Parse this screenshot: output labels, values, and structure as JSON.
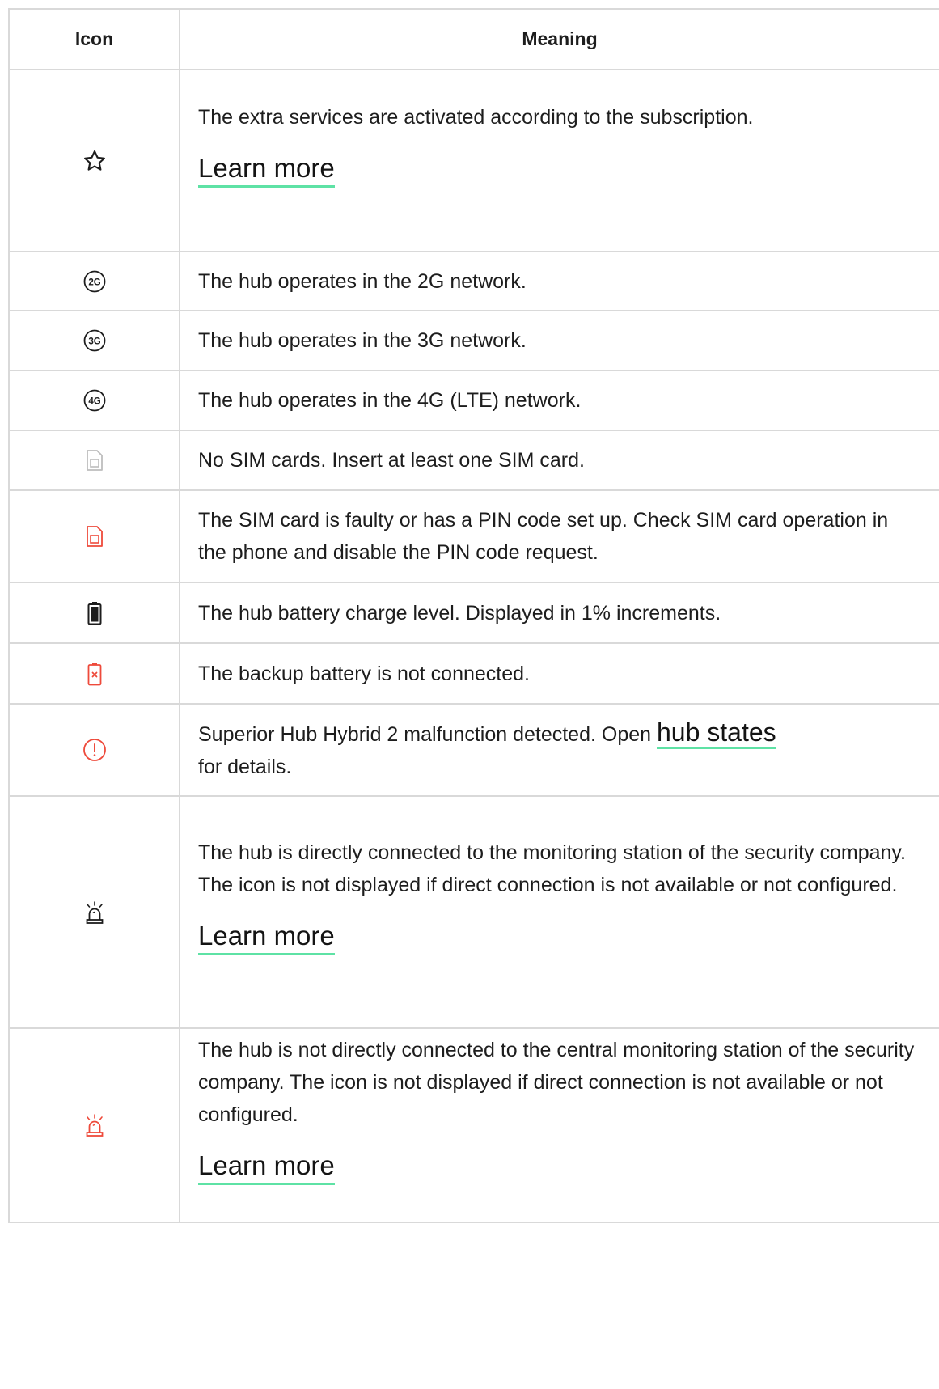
{
  "header": {
    "icon": "Icon",
    "meaning": "Meaning"
  },
  "colors": {
    "accent": "#5ee2a5",
    "red": "#ee4a3b",
    "border": "#d9d9d9",
    "grey_icon": "#bdbdbd"
  },
  "rows": [
    {
      "icon": "star-icon",
      "text": "The extra services are activated according to the subscription.",
      "link": "Learn more"
    },
    {
      "icon": "network-2g-icon",
      "badge": "2G",
      "text": "The hub operates in the 2G network."
    },
    {
      "icon": "network-3g-icon",
      "badge": "3G",
      "text": "The hub operates in the 3G network."
    },
    {
      "icon": "network-4g-icon",
      "badge": "4G",
      "text": "The hub operates in the 4G (LTE) network."
    },
    {
      "icon": "sim-card-empty-icon",
      "text": "No SIM cards. Insert at least one SIM card."
    },
    {
      "icon": "sim-card-error-icon",
      "text": "The SIM card is faulty or has a PIN code set up. Check SIM card operation in the phone and disable the PIN code request."
    },
    {
      "icon": "battery-icon",
      "text": "The hub battery charge level. Displayed in 1% increments."
    },
    {
      "icon": "battery-disconnected-icon",
      "text": "The backup battery is not connected."
    },
    {
      "icon": "malfunction-icon",
      "text_before": "Superior Hub Hybrid 2 malfunction detected. Open",
      "link": "hub states",
      "text_after": "for details."
    },
    {
      "icon": "monitoring-siren-icon",
      "text": "The hub is directly connected to the monitoring station of the security company. The icon is not displayed if direct connection is not available or not configured.",
      "link": "Learn more"
    },
    {
      "icon": "monitoring-siren-red-icon",
      "text": "The hub is not directly connected to the central monitoring station of the security company. The icon is not displayed if direct connection is not available or not configured.",
      "link": "Learn more"
    }
  ]
}
